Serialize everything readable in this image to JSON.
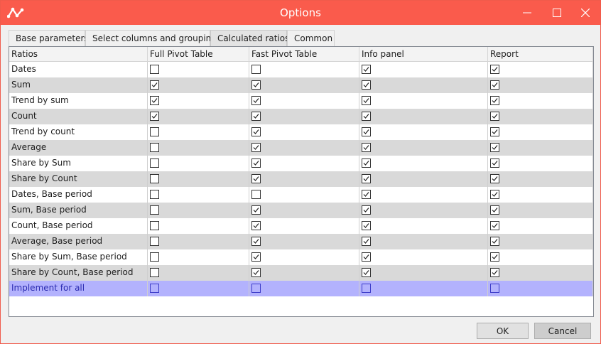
{
  "window": {
    "title": "Options"
  },
  "tabs": [
    {
      "label": "Base parameters"
    },
    {
      "label": "Select columns and grouping"
    },
    {
      "label": "Calculated ratios"
    },
    {
      "label": "Common"
    }
  ],
  "grid": {
    "columns": [
      "Ratios",
      "Full Pivot Table",
      "Fast Pivot Table",
      "Info panel",
      "Report"
    ],
    "rows": [
      {
        "name": "Dates",
        "checks": [
          false,
          false,
          true,
          true
        ]
      },
      {
        "name": "Sum",
        "checks": [
          true,
          true,
          true,
          true
        ]
      },
      {
        "name": "Trend by sum",
        "checks": [
          true,
          true,
          true,
          true
        ]
      },
      {
        "name": "Count",
        "checks": [
          true,
          true,
          true,
          true
        ]
      },
      {
        "name": "Trend by count",
        "checks": [
          false,
          true,
          true,
          true
        ]
      },
      {
        "name": "Average",
        "checks": [
          false,
          true,
          true,
          true
        ]
      },
      {
        "name": "Share by Sum",
        "checks": [
          false,
          true,
          true,
          true
        ]
      },
      {
        "name": "Share by Count",
        "checks": [
          false,
          true,
          true,
          true
        ]
      },
      {
        "name": "Dates, Base period",
        "checks": [
          false,
          false,
          true,
          true
        ]
      },
      {
        "name": "Sum, Base period",
        "checks": [
          false,
          true,
          true,
          true
        ]
      },
      {
        "name": "Count, Base period",
        "checks": [
          false,
          true,
          true,
          true
        ]
      },
      {
        "name": "Average, Base period",
        "checks": [
          false,
          true,
          true,
          true
        ]
      },
      {
        "name": "Share by Sum, Base period",
        "checks": [
          false,
          true,
          true,
          true
        ]
      },
      {
        "name": "Share by Count, Base period",
        "checks": [
          false,
          true,
          true,
          true
        ]
      }
    ],
    "footer": {
      "name": "Implement for all",
      "checks": [
        false,
        false,
        false,
        false
      ]
    }
  },
  "buttons": {
    "ok": "OK",
    "cancel": "Cancel"
  },
  "colors": {
    "titlebar": "#fa5b4c",
    "footer_row": "#b3b2fd",
    "alt_row": "#d9d9d9"
  }
}
